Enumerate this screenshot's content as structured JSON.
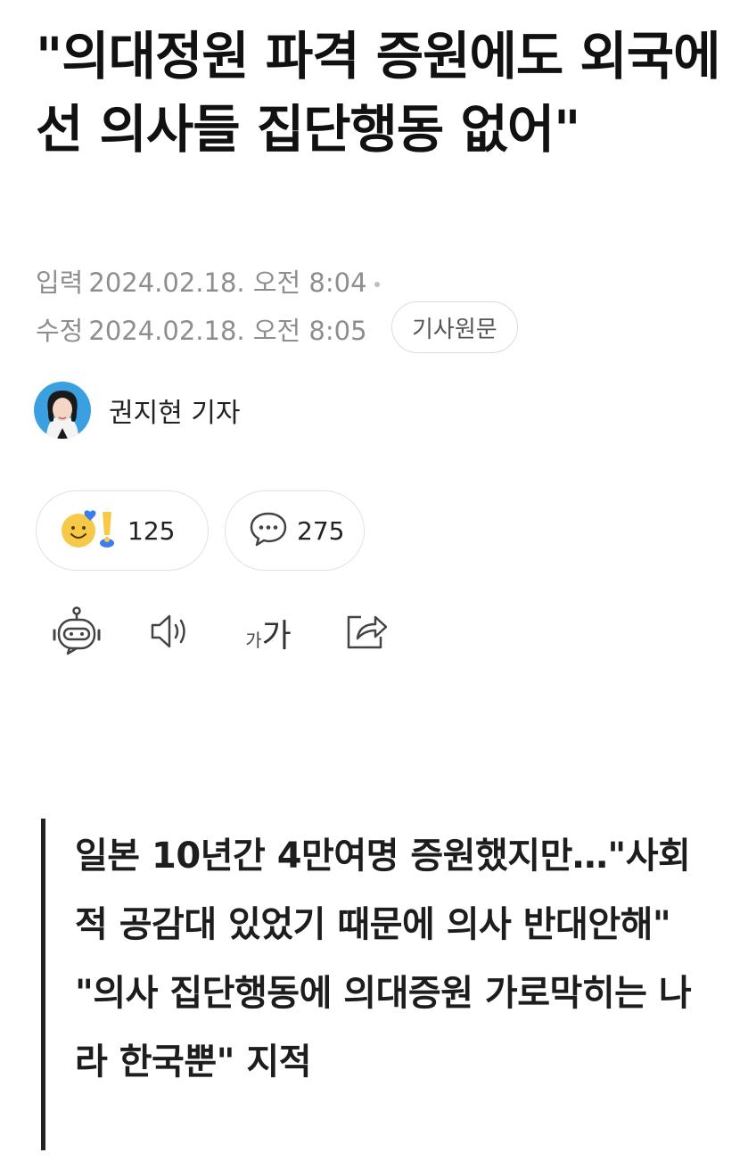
{
  "article": {
    "headline": "\"의대정원 파격 증원에도 외국에선 의사들 집단행동 없어\"",
    "published_label": "입력",
    "published_value": "2024.02.18. 오전 8:04",
    "modified_label": "수정",
    "modified_value": "2024.02.18. 오전 8:05",
    "original_button": "기사원문"
  },
  "author": {
    "name": "권지현 기자",
    "avatar_icon": "reporter-avatar"
  },
  "reactions": {
    "reaction_count": "125",
    "comment_count": "275",
    "reaction_icons": [
      "smile-heart-emoji",
      "exclamation-emoji"
    ],
    "comment_icon": "speech-bubble-icon"
  },
  "toolbar": {
    "items": [
      {
        "name": "summary-bot-icon"
      },
      {
        "name": "speaker-icon"
      },
      {
        "name": "font-size-icon",
        "small": "가",
        "large": "가"
      },
      {
        "name": "share-icon"
      }
    ]
  },
  "summary": {
    "lines": [
      "일본 10년간 4만여명 증원했지만…\"사회적 공감대 있었기 때문에 의사 반대안해\"",
      "\"의사 집단행동에 의대증원 가로막히는 나라 한국뿐\" 지적"
    ]
  },
  "colors": {
    "meta_gray": "#8e8e8e",
    "border_gray": "#e2e2e2",
    "emoji_yellow": "#f7c948",
    "emoji_blue": "#3d7bf0"
  }
}
